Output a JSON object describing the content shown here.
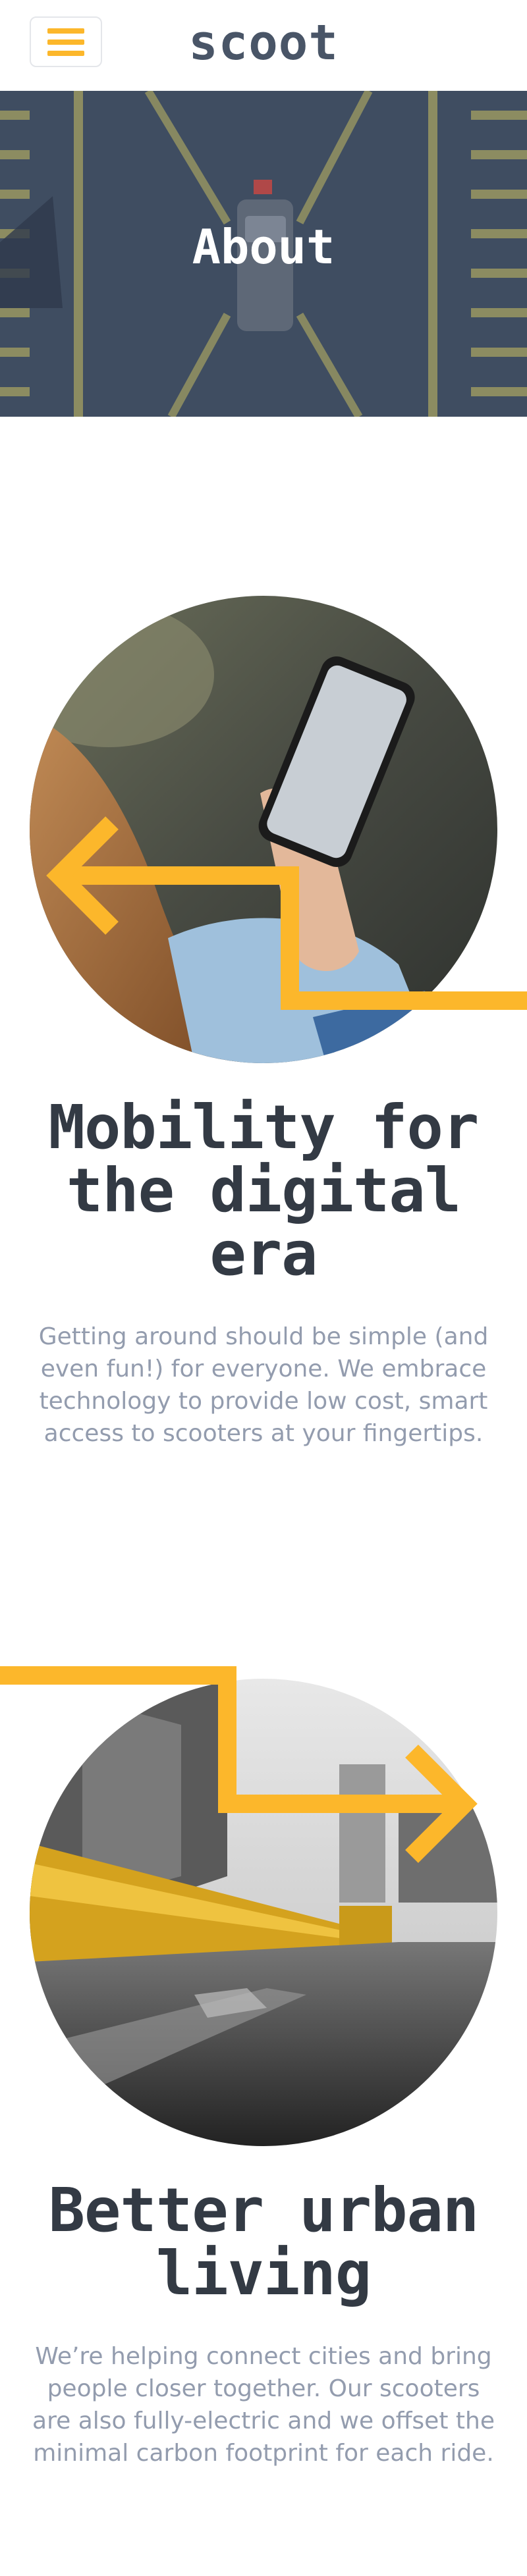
{
  "header": {
    "logo": "scoot",
    "menu_icon": "hamburger-menu-icon"
  },
  "hero": {
    "title": "About"
  },
  "sections": [
    {
      "title_lines": [
        "Mobility for",
        "the digital",
        "era"
      ],
      "text": "Getting around should be simple (and even fun!) for everyone. We embrace technology to provide low cost, smart access to scooters at your fingertips."
    },
    {
      "title_lines": [
        "Better urban",
        "living"
      ],
      "text": "We’re helping connect cities and bring people closer together. Our scooters are also fully-electric and we offset the minimal carbon footprint for each ride."
    }
  ],
  "colors": {
    "accent": "#fcb72b",
    "heading": "#333a44",
    "body": "#939cae",
    "navy": "#495567"
  }
}
